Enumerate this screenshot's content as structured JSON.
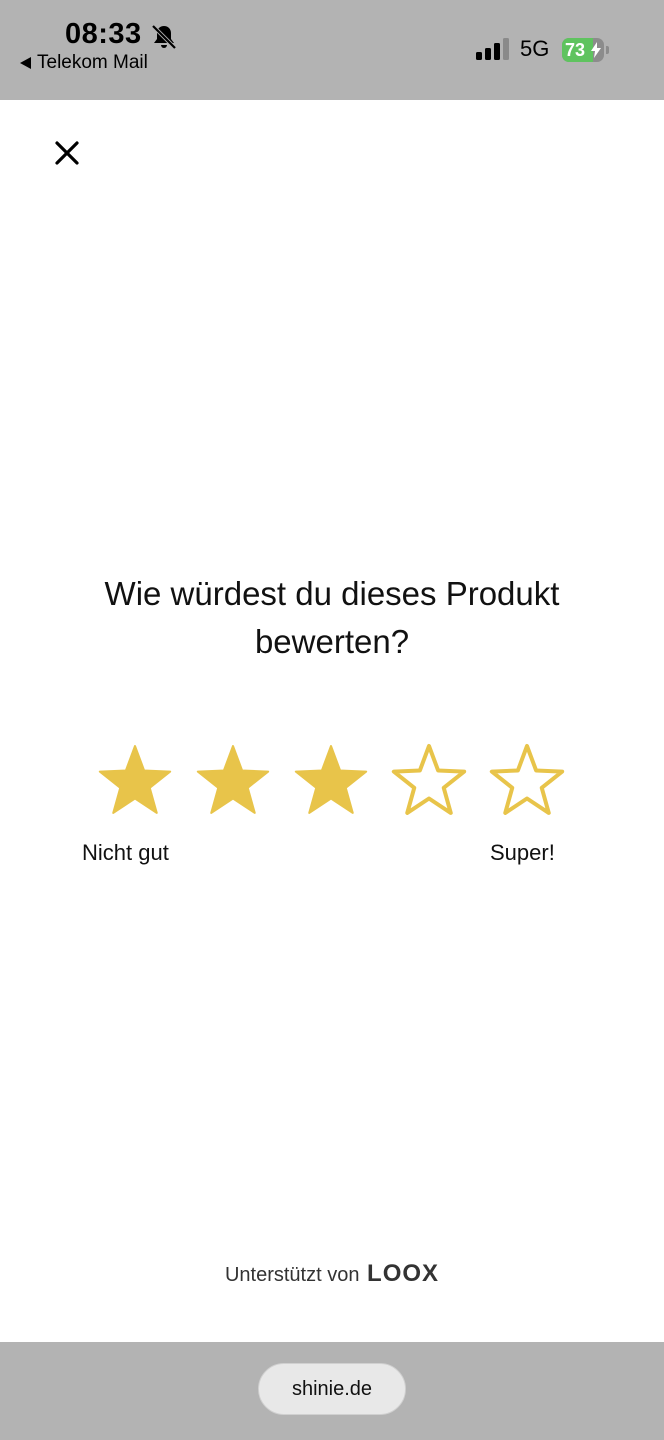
{
  "status_bar": {
    "time": "08:33",
    "back_app": "Telekom Mail",
    "network": "5G",
    "battery_level": "73",
    "battery_fraction": 0.73
  },
  "survey": {
    "question": "Wie würdest du dieses Produkt bewerten?",
    "rating": 3,
    "max_rating": 5,
    "label_low": "Nicht gut",
    "label_high": "Super!",
    "star_color": "#e8c44a"
  },
  "footer": {
    "powered_by": "Unterstützt von",
    "brand": "LOOX"
  },
  "browser": {
    "url": "shinie.de"
  }
}
